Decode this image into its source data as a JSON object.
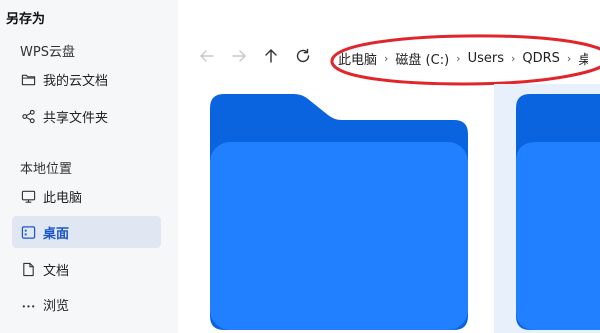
{
  "dialog": {
    "title": "另存为"
  },
  "sidebar": {
    "cloud_section": "WPS云盘",
    "cloud_items": [
      {
        "label": "我的云文档",
        "icon": "folder-icon"
      },
      {
        "label": "共享文件夹",
        "icon": "share-icon"
      }
    ],
    "local_section": "本地位置",
    "local_items": [
      {
        "label": "此电脑",
        "icon": "monitor-icon"
      },
      {
        "label": "桌面",
        "icon": "desktop-icon",
        "active": true
      },
      {
        "label": "文档",
        "icon": "document-icon"
      },
      {
        "label": "浏览",
        "icon": "more-icon"
      }
    ]
  },
  "toolbar": {
    "back_icon": "arrow-left-icon",
    "forward_icon": "arrow-right-icon",
    "up_icon": "arrow-up-icon",
    "refresh_icon": "refresh-icon"
  },
  "breadcrumb": {
    "items": [
      "此电脑",
      "磁盘 (C:)",
      "Users",
      "QDRS",
      "桌"
    ]
  },
  "colors": {
    "accent": "#1a56c9",
    "folder_front": "#2080ff",
    "folder_back": "#0a63df",
    "annotation": "#e0262b",
    "sidebar_bg": "#f6f7f9",
    "active_bg": "#e1e7f2"
  }
}
